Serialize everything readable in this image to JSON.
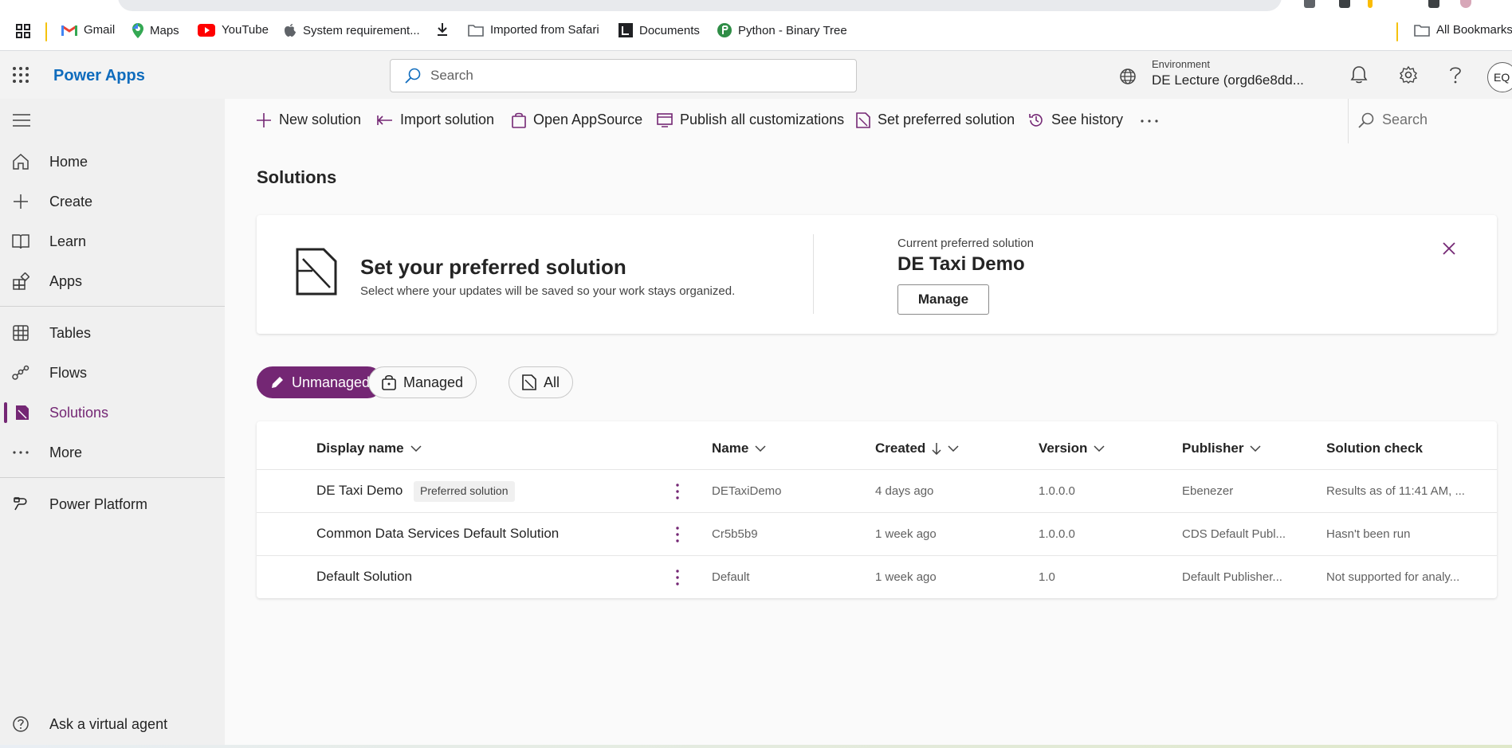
{
  "browser": {
    "bookmarks": [
      {
        "label": "Gmail",
        "icon": "gmail-icon"
      },
      {
        "label": "Maps",
        "icon": "maps-pin-icon"
      },
      {
        "label": "YouTube",
        "icon": "youtube-icon"
      },
      {
        "label": "System requirement...",
        "icon": "apple-icon"
      },
      {
        "label": "Imported from Safari",
        "icon": "folder-icon"
      },
      {
        "label": "Documents",
        "icon": "documents-icon"
      },
      {
        "label": "Python - Binary Tree",
        "icon": "python-icon"
      }
    ],
    "all_bookmarks": "All Bookmarks"
  },
  "header": {
    "app_title": "Power Apps",
    "search_placeholder": "Search",
    "environment_label": "Environment",
    "environment_name": "DE Lecture (orgd6e8dd...",
    "avatar_initials": "EQ"
  },
  "nav": {
    "items": [
      {
        "label": "Home",
        "icon": "home-icon"
      },
      {
        "label": "Create",
        "icon": "plus-icon"
      },
      {
        "label": "Learn",
        "icon": "book-icon"
      },
      {
        "label": "Apps",
        "icon": "apps-icon"
      },
      {
        "label": "Tables",
        "icon": "table-icon"
      },
      {
        "label": "Flows",
        "icon": "flow-icon"
      },
      {
        "label": "Solutions",
        "icon": "solutions-icon"
      },
      {
        "label": "More",
        "icon": "ellipsis-icon"
      },
      {
        "label": "Power Platform",
        "icon": "power-platform-icon"
      }
    ],
    "active": "Solutions",
    "virtual_agent": "Ask a virtual agent"
  },
  "commands": {
    "new_solution": "New solution",
    "import_solution": "Import solution",
    "open_appsource": "Open AppSource",
    "publish_all": "Publish all customizations",
    "set_preferred": "Set preferred solution",
    "see_history": "See history",
    "search_placeholder": "Search"
  },
  "page": {
    "title": "Solutions",
    "preferred": {
      "heading": "Set your preferred solution",
      "description": "Select where your updates will be saved so your work stays organized.",
      "current_label": "Current preferred solution",
      "current_name": "DE Taxi Demo",
      "manage_label": "Manage"
    },
    "filters": [
      "Unmanaged",
      "Managed",
      "All"
    ],
    "active_filter": "Unmanaged",
    "columns": {
      "display_name": "Display name",
      "name": "Name",
      "created": "Created",
      "version": "Version",
      "publisher": "Publisher",
      "solution_check": "Solution check"
    },
    "rows": [
      {
        "display_name": "DE Taxi Demo",
        "badge": "Preferred solution",
        "name": "DETaxiDemo",
        "created": "4 days ago",
        "version": "1.0.0.0",
        "publisher": "Ebenezer",
        "solution_check": "Results as of 11:41 AM, ..."
      },
      {
        "display_name": "Common Data Services Default Solution",
        "badge": "",
        "name": "Cr5b5b9",
        "created": "1 week ago",
        "version": "1.0.0.0",
        "publisher": "CDS Default Publ...",
        "solution_check": "Hasn't been run"
      },
      {
        "display_name": "Default Solution",
        "badge": "",
        "name": "Default",
        "created": "1 week ago",
        "version": "1.0",
        "publisher": "Default Publisher...",
        "solution_check": "Not supported for analy..."
      }
    ]
  },
  "colors": {
    "accent": "#742774",
    "brand_blue": "#0f6cbd",
    "nav_bg": "#f0f0f0"
  }
}
